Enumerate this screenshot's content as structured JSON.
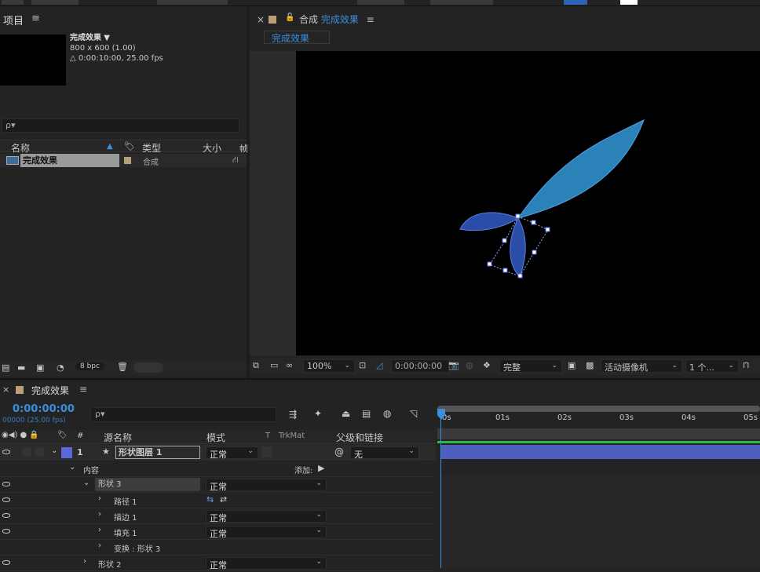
{
  "project": {
    "title": "项目",
    "comp_name": "完成效果",
    "comp_size": "800 x 600 (1.00)",
    "comp_duration": "△ 0:00:10:00, 25.00 fps",
    "search_placeholder": "ρ▾",
    "columns": [
      "名称",
      "类型",
      "大小",
      "帧"
    ],
    "items": [
      {
        "name": "完成效果",
        "type": "合成"
      }
    ],
    "bpc": "8 bpc"
  },
  "viewer": {
    "close": "×",
    "lock": "🔒",
    "title_prefix": "合成",
    "title_name": "完成效果",
    "menu": "≡",
    "breadcrumb": "完成效果",
    "zoom": "100%",
    "timecode": "0:00:00:00",
    "resolution": "完整",
    "camera": "活动摄像机",
    "views": "1 个..."
  },
  "timeline": {
    "close": "×",
    "title": "完成效果",
    "menu": "≡",
    "timecode": "0:00:00:00",
    "frames": "00000 (25.00 fps)",
    "search_placeholder": "ρ▾",
    "columns": {
      "num": "#",
      "source": "源名称",
      "mode": "模式",
      "t": "T",
      "trkmat": "TrkMat",
      "parent": "父级和链接"
    },
    "ruler": [
      "0s",
      "01s",
      "02s",
      "03s",
      "04s",
      "05s"
    ],
    "layer": {
      "num": "1",
      "name": "形状图层 1",
      "mode": "正常",
      "parent": "无"
    },
    "contents": "内容",
    "add_label": "添加:",
    "rows": [
      {
        "label": "形状 3",
        "mode": "正常"
      },
      {
        "label": "路径 1"
      },
      {
        "label": "描边 1",
        "mode": "正常"
      },
      {
        "label": "填充 1",
        "mode": "正常"
      },
      {
        "label": "变换 : 形状 3"
      },
      {
        "label": "形状 2",
        "mode": "正常"
      }
    ]
  },
  "colors": {
    "accent": "#3a8fe0",
    "layer_bar": "#4f5fc0",
    "leaf_big": "#2a82b8",
    "leaf_small": "#2a4ea8"
  }
}
